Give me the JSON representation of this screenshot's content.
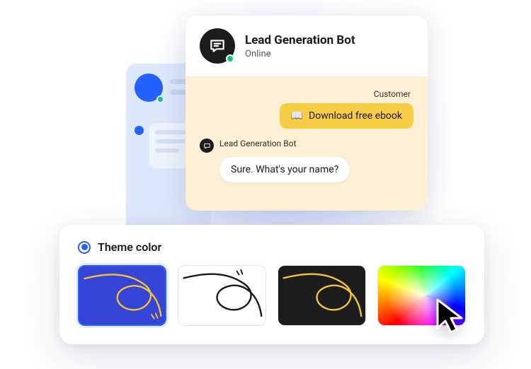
{
  "chat": {
    "header": {
      "title": "Lead Generation Bot",
      "status": "Online"
    },
    "messages": {
      "customer": {
        "label": "Customer",
        "icon": "📖",
        "text": "Download free ebook"
      },
      "bot": {
        "label": "Lead Generation Bot",
        "text": "Sure. What's your name?"
      }
    }
  },
  "theme": {
    "title": "Theme color",
    "options": [
      {
        "id": "blue",
        "selected": true
      },
      {
        "id": "white",
        "selected": false
      },
      {
        "id": "dark",
        "selected": false
      },
      {
        "id": "custom",
        "selected": false
      }
    ]
  }
}
